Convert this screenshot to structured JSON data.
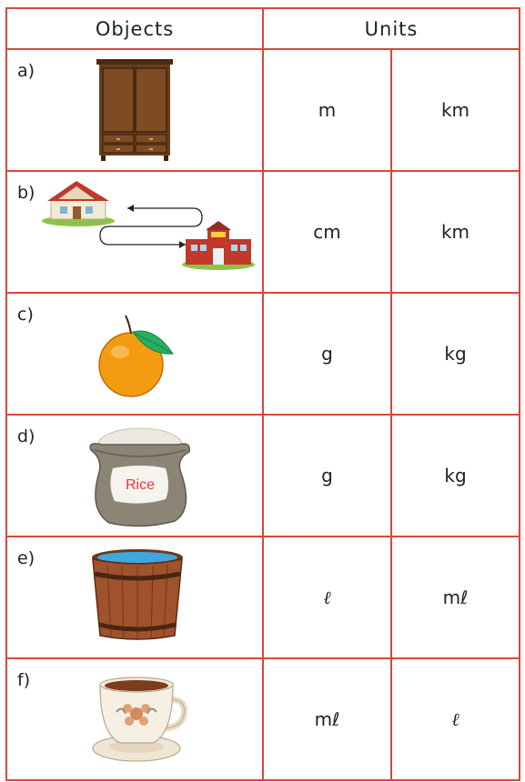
{
  "header": {
    "objects": "Objects",
    "units": "Units"
  },
  "rows": [
    {
      "letter": "a)",
      "object_icon": "wardrobe-icon",
      "unit_1": "m",
      "unit_2": "km"
    },
    {
      "letter": "b)",
      "object_icon": "house-to-school-route-icon",
      "unit_1": "cm",
      "unit_2": "km"
    },
    {
      "letter": "c)",
      "object_icon": "orange-icon",
      "unit_1": "g",
      "unit_2": "kg"
    },
    {
      "letter": "d)",
      "object_icon": "rice-sack-icon",
      "sack_label": "Rice",
      "unit_1": "g",
      "unit_2": "kg"
    },
    {
      "letter": "e)",
      "object_icon": "wooden-bucket-icon",
      "unit_1": "ℓ",
      "unit_2": "mℓ"
    },
    {
      "letter": "f)",
      "object_icon": "teacup-icon",
      "unit_1": "mℓ",
      "unit_2": "ℓ"
    }
  ],
  "colors": {
    "grid": "#d9473b",
    "text": "#222222"
  }
}
